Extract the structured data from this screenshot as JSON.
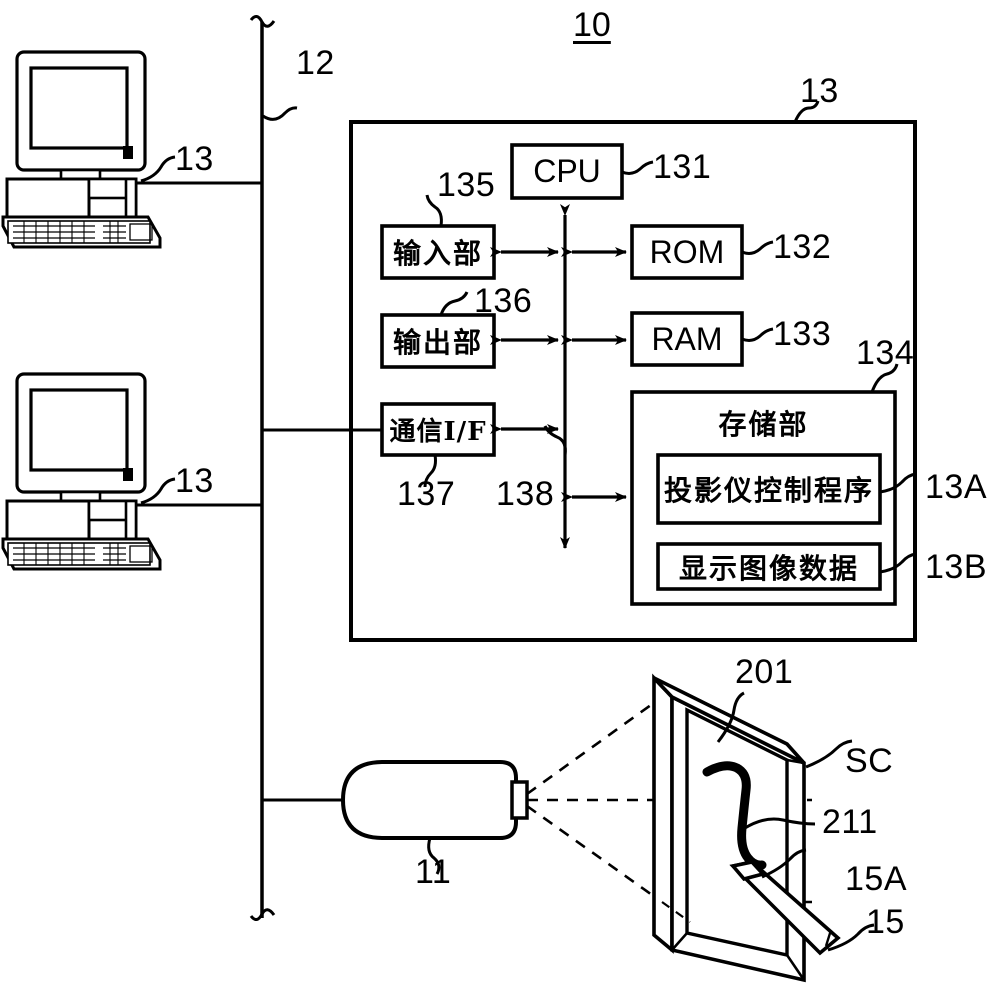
{
  "figure": {
    "system_label": "10",
    "network_bus_label": "12",
    "terminals": [
      {
        "id": "terminal-top",
        "label": "13"
      },
      {
        "id": "terminal-bottom",
        "label": "13"
      }
    ],
    "controller": {
      "label": "13",
      "blocks": {
        "cpu": {
          "text": "CPU",
          "ref": "131"
        },
        "rom": {
          "text": "ROM",
          "ref": "132"
        },
        "ram": {
          "text": "RAM",
          "ref": "133"
        },
        "input": {
          "text": "输入部",
          "ref": "135"
        },
        "output": {
          "text": "输出部",
          "ref": "136"
        },
        "comm": {
          "text": "通信I/F",
          "ref": "137"
        },
        "bus": {
          "ref": "138"
        },
        "storage": {
          "text": "存储部",
          "ref": "134",
          "items": [
            {
              "text": "投影仪控制程序",
              "ref": "13A"
            },
            {
              "text": "显示图像数据",
              "ref": "13B"
            }
          ]
        }
      }
    },
    "projector": {
      "label": "11"
    },
    "screen": {
      "label": "SC",
      "projection_area_ref": "201",
      "drawn_line_ref": "211"
    },
    "pen": {
      "label": "15",
      "tip_label": "15A"
    }
  },
  "colors": {
    "ink": "#000000",
    "paper": "#ffffff"
  }
}
